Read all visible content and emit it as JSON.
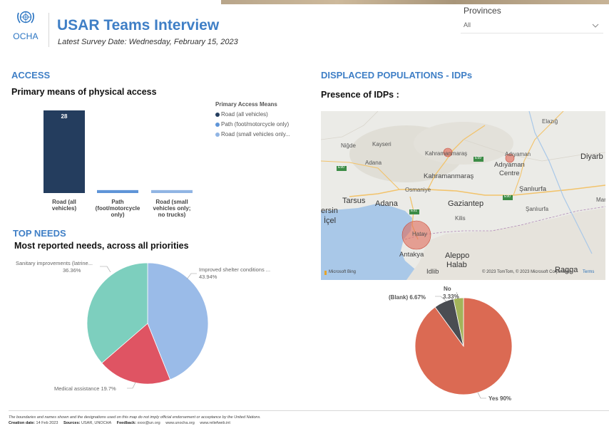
{
  "header": {
    "logo_text": "OCHA",
    "title": "USAR Teams Interview",
    "survey_date": "Latest Survey Date:  Wednesday, February 15, 2023"
  },
  "filter": {
    "label": "Provinces",
    "value": "All"
  },
  "access": {
    "section_title": "ACCESS",
    "subtitle": "Primary means of physical access",
    "legend_title": "Primary Access Means"
  },
  "needs": {
    "section_title": "TOP NEEDS",
    "subtitle": "Most reported needs, across all priorities"
  },
  "idps": {
    "section_title": "DISPLACED POPULATIONS  - IDPs",
    "subtitle": "Presence of IDPs :"
  },
  "map": {
    "labels": {
      "nigde": "Niğde",
      "kayseri": "Kayseri",
      "adana_small": "Adana",
      "kahramanmaras_small": "Kahramanmaraş",
      "adiyaman_small": "Adıyaman",
      "elazig": "Elazığ",
      "adiyaman": "Adıyaman",
      "centre": "Centre",
      "diyarbakir": "Diyarb",
      "kahramanmaras": "Kahramanmaraş",
      "osmaniye": "Osmaniye",
      "sanliurfa": "Şanlıurfa",
      "sanliurfa_small": "Şanlıurfa",
      "tarsus": "Tarsus",
      "adana": "Adana",
      "gaziantep": "Gaziantep",
      "mersin": "ersin",
      "icel": "İçel",
      "kilis": "Kilis",
      "hatay": "Hatay",
      "antakya": "Antakya",
      "aleppo": "Aleppo",
      "halab": "Halab",
      "idlib": "Idlib",
      "ma": "Mar",
      "ragga": "Ragga",
      "e90a": "E90",
      "e90b": "E90",
      "e91": "E91",
      "e99": "E99"
    },
    "attribution": "Microsoft Bing",
    "copyright": "© 2023 TomTom, © 2023 Microsoft Corporation",
    "terms": "Terms"
  },
  "footer": {
    "disclaimer": "The boundaries and names shown and the designations used on this map do not imply official endorsement or acceptance by the United Nations.",
    "creation_label": "Creation date:",
    "creation_value": "14 Feb 2023",
    "sources_label": "Sources:",
    "sources_value": "USAR, UNOCHA",
    "feedback_label": "Feedback:",
    "feedback_value": "xxxx@un.org",
    "link1": "www.unocha.org",
    "link2": "www.reliefweb.int"
  },
  "colors": {
    "accent": "#3f7fc6",
    "bar_dark": "#243d5e",
    "bar_mid": "#5f95d8",
    "bar_light": "#91b5e4",
    "pie_shelter": "#9abbe8",
    "pie_medical": "#df5463",
    "pie_sanitary": "#7dcfbe",
    "pie_yes": "#db6a53",
    "pie_blank": "#4a4d52",
    "pie_no": "#a3b45a"
  },
  "chart_data": [
    {
      "type": "bar",
      "title": "Primary means of physical access",
      "categories": [
        "Road (all vehicles)",
        "Path (foot/motorcycle only)",
        "Road (small vehicles only; no trucks)"
      ],
      "category_labels": [
        [
          "Road (all",
          "vehicles)"
        ],
        [
          "Path",
          "(foot/motorcycle",
          "only)"
        ],
        [
          "Road (small",
          "vehicles only;",
          "no trucks)"
        ]
      ],
      "values": [
        28,
        1,
        1
      ],
      "data_labels": [
        "28",
        "",
        ""
      ],
      "ylim": [
        0,
        28
      ],
      "legend": {
        "title": "Primary Access Means",
        "placement": "right",
        "entries": [
          "Road (all vehicles)",
          "Path (foot/motorcycle only)",
          "Road (small vehicles only..."
        ]
      },
      "grid": false
    },
    {
      "type": "pie",
      "title": "Most reported needs, across all priorities",
      "series": [
        {
          "name": "Improved shelter conditions ...",
          "value": 43.94,
          "label": "43.94%"
        },
        {
          "name": "Medical assistance",
          "value": 19.7,
          "label": "19.7%"
        },
        {
          "name": "Sanitary improvements (latrine...",
          "value": 36.36,
          "label": "36.36%"
        }
      ],
      "legend": {
        "placement": "none"
      }
    },
    {
      "type": "pie",
      "title": "Presence of IDPs :",
      "series": [
        {
          "name": "Yes",
          "value": 90,
          "label": "90%"
        },
        {
          "name": "(Blank)",
          "value": 6.67,
          "label": "6.67%"
        },
        {
          "name": "No",
          "value": 3.33,
          "label": "3.33%"
        }
      ],
      "legend": {
        "placement": "none"
      }
    }
  ]
}
